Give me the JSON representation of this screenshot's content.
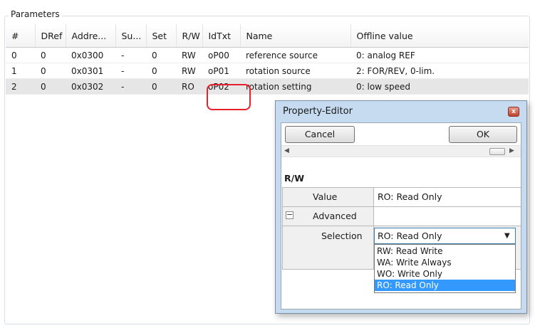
{
  "group": {
    "title": "Parameters"
  },
  "table": {
    "headers": [
      "#",
      "DRef",
      "Addre...",
      "Su...",
      "Set",
      "R/W",
      "IdTxt",
      "Name",
      "Offline value"
    ],
    "rows": [
      [
        "0",
        "0",
        "0x0300",
        "-",
        "0",
        "RW",
        "oP00",
        "reference source",
        "0: analog REF"
      ],
      [
        "1",
        "0",
        "0x0301",
        "-",
        "0",
        "RW",
        "oP01",
        "rotation source",
        "2: FOR/REV, 0-lim."
      ],
      [
        "2",
        "0",
        "0x0302",
        "-",
        "0",
        "RO",
        "oP02",
        "rotation setting",
        "0: low speed"
      ]
    ],
    "selected_row": 2
  },
  "dialog": {
    "title": "Property-Editor",
    "close_symbol": "x",
    "cancel_label": "Cancel",
    "ok_label": "OK",
    "scroll_left_icon": "◀",
    "scroll_right_icon": "▶",
    "category": "R/W",
    "properties": {
      "value_label": "Value",
      "value": "RO: Read Only",
      "advanced_label": "Advanced",
      "advanced_toggle": "−",
      "selection_label": "Selection",
      "selection_value": "RO: Read Only"
    },
    "dropdown": {
      "chevron_icon": "▼",
      "options": [
        "RW: Read Write",
        "WA: Write Always",
        "WO: Write Only",
        "RO: Read Only"
      ],
      "selected_index": 3
    }
  },
  "colors": {
    "highlight": "#e8202c",
    "selection_blue": "#3399ff",
    "dialog_frame": "#c6dbf0"
  }
}
